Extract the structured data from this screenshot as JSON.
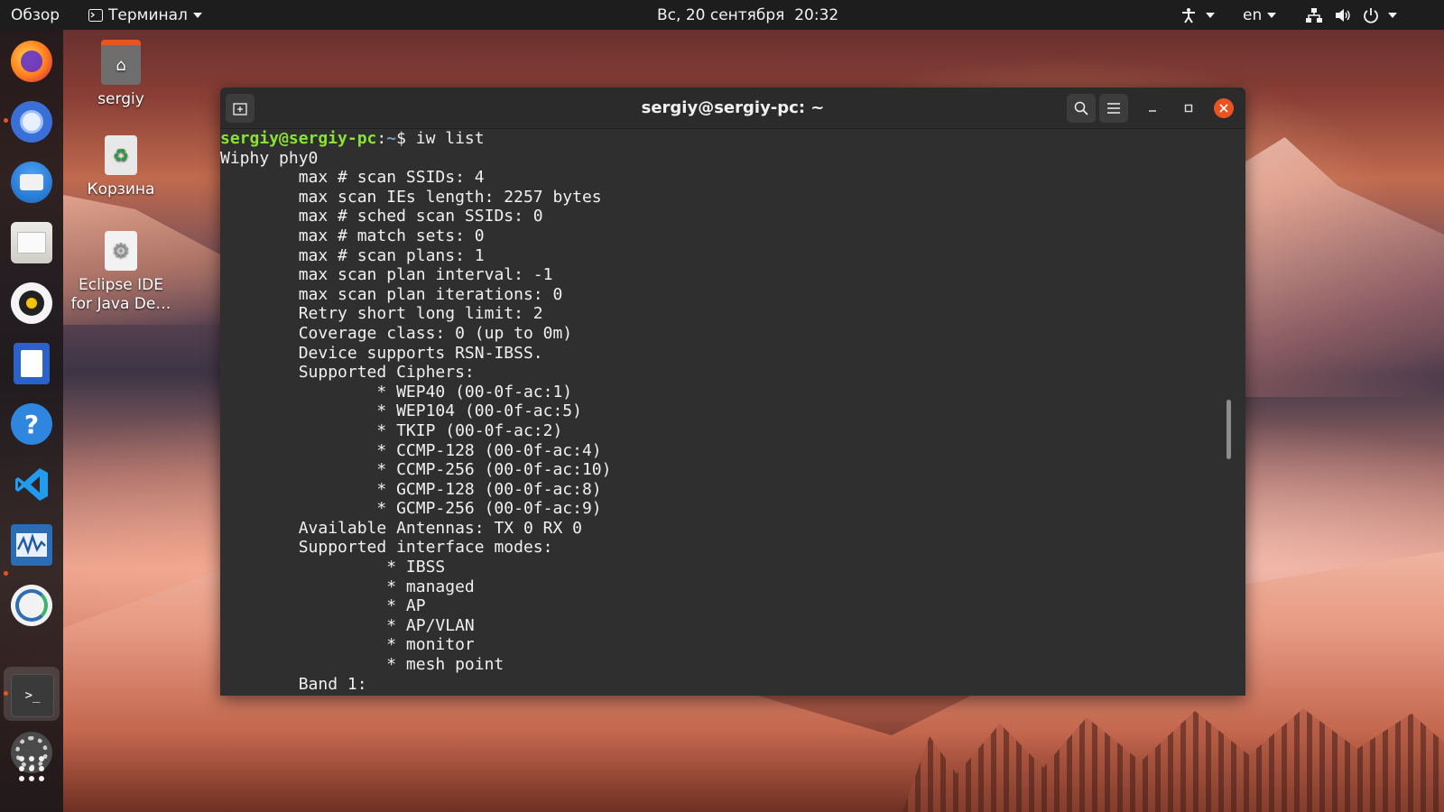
{
  "topbar": {
    "overview": "Обзор",
    "app_menu": "Терминал",
    "clock": "Вс, 20 сентября  20:32",
    "language": "en"
  },
  "dock": {
    "apps": [
      "firefox",
      "chromium",
      "thunderbird",
      "files",
      "rhythmbox",
      "writer",
      "help",
      "vscode",
      "system-monitor",
      "remote-desktop",
      "terminal",
      "settings",
      "show-apps"
    ]
  },
  "desktop": {
    "home_label": "sergiy",
    "trash_label": "Корзина",
    "eclipse_label_line1": "Eclipse IDE",
    "eclipse_label_line2": "for Java De…"
  },
  "terminal": {
    "title": "sergiy@sergiy-pc: ~",
    "prompt_user": "sergiy@sergiy-pc",
    "prompt_sep": ":",
    "prompt_path": "~",
    "prompt_cmd": "$ iw list",
    "lines": [
      "Wiphy phy0",
      "\tmax # scan SSIDs: 4",
      "\tmax scan IEs length: 2257 bytes",
      "\tmax # sched scan SSIDs: 0",
      "\tmax # match sets: 0",
      "\tmax # scan plans: 1",
      "\tmax scan plan interval: -1",
      "\tmax scan plan iterations: 0",
      "\tRetry short long limit: 2",
      "\tCoverage class: 0 (up to 0m)",
      "\tDevice supports RSN-IBSS.",
      "\tSupported Ciphers:",
      "\t\t* WEP40 (00-0f-ac:1)",
      "\t\t* WEP104 (00-0f-ac:5)",
      "\t\t* TKIP (00-0f-ac:2)",
      "\t\t* CCMP-128 (00-0f-ac:4)",
      "\t\t* CCMP-256 (00-0f-ac:10)",
      "\t\t* GCMP-128 (00-0f-ac:8)",
      "\t\t* GCMP-256 (00-0f-ac:9)",
      "\tAvailable Antennas: TX 0 RX 0",
      "\tSupported interface modes:",
      "\t\t * IBSS",
      "\t\t * managed",
      "\t\t * AP",
      "\t\t * AP/VLAN",
      "\t\t * monitor",
      "\t\t * mesh point",
      "\tBand 1:"
    ]
  }
}
